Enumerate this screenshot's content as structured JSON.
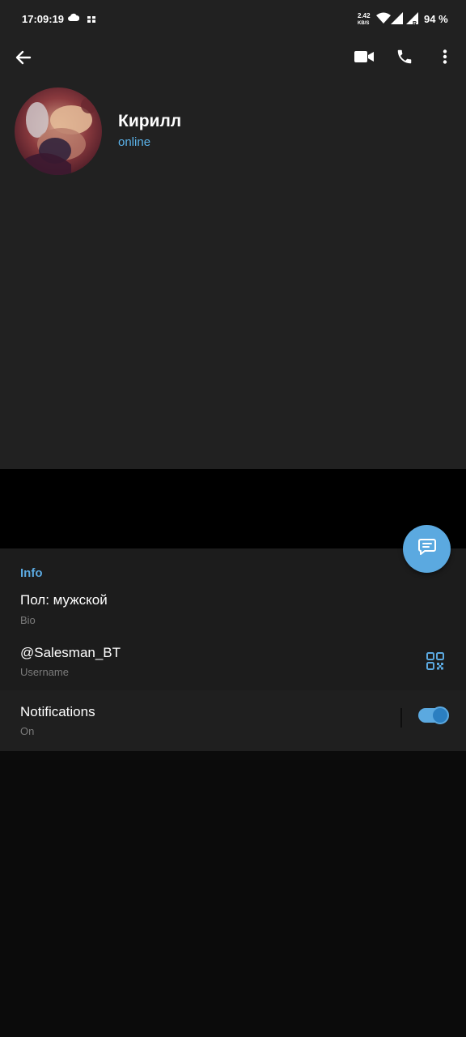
{
  "status_bar": {
    "time": "17:09:19",
    "net_speed_value": "2.42",
    "net_speed_unit": "KB/S",
    "battery": "94 %",
    "icons": [
      "cloud-icon",
      "gift-icon",
      "wifi-icon",
      "signal-icon",
      "signal-roaming-icon"
    ]
  },
  "toolbar": {
    "back_icon": "arrow-left-icon",
    "video_call_icon": "video-camera-icon",
    "voice_call_icon": "phone-icon",
    "more_icon": "more-vertical-icon"
  },
  "profile": {
    "name": "Кирилл",
    "status": "online"
  },
  "info": {
    "section_title": "Info",
    "bio_value": "Пол: мужской",
    "bio_label": "Bio",
    "username_value": "@Salesman_BT",
    "username_label": "Username",
    "notifications_title": "Notifications",
    "notifications_state": "On",
    "notifications_enabled": true
  },
  "fab": {
    "icon": "message-icon"
  },
  "colors": {
    "accent": "#5ba9e0",
    "header_bg": "#212121",
    "section_bg": "#1c1c1c",
    "page_bg": "#0b0b0b",
    "secondary_text": "#7b7b7b"
  }
}
